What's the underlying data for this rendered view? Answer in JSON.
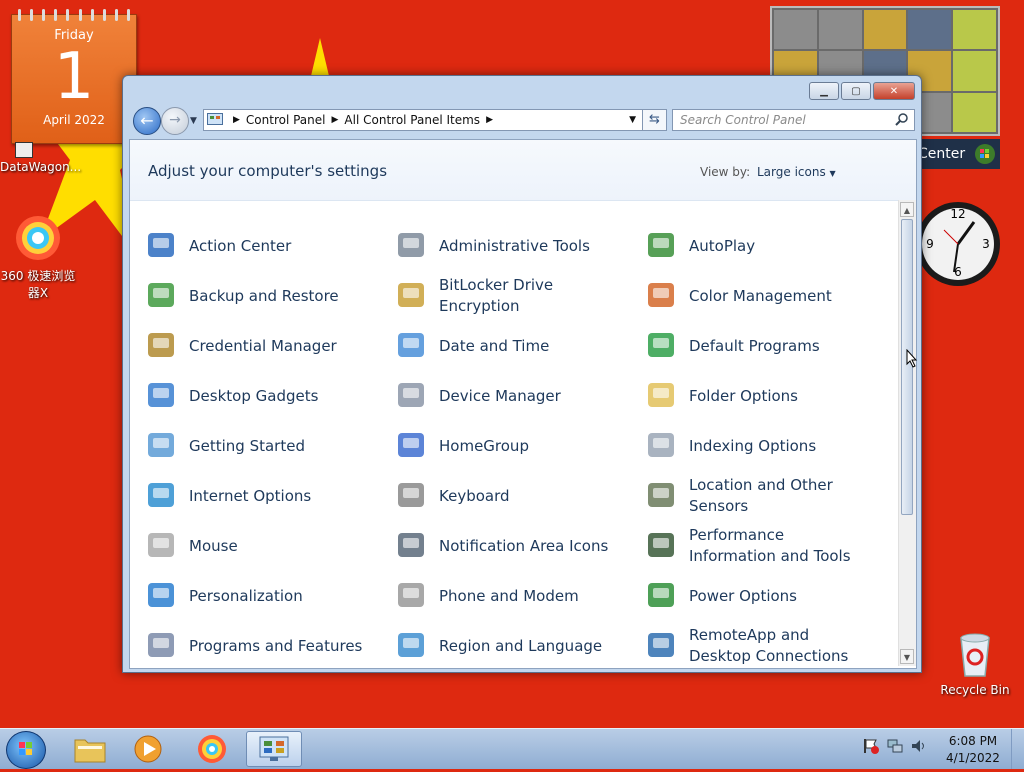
{
  "desktop": {
    "calendar": {
      "weekday": "Friday",
      "day": "1",
      "month_year": "April 2022"
    },
    "icons": [
      {
        "label": "DataWagon..."
      },
      {
        "label": "360 极速浏览器X"
      },
      {
        "label": "Recycle Bin"
      }
    ],
    "media_center_label": "Center",
    "clock_numbers": [
      "12",
      "3",
      "6",
      "9"
    ]
  },
  "window": {
    "address": {
      "crumbs": [
        "Control Panel",
        "All Control Panel Items"
      ]
    },
    "search": {
      "placeholder": "Search Control Panel"
    },
    "header_title": "Adjust your computer's settings",
    "view_by_label": "View by:",
    "view_by_value": "Large icons",
    "items": [
      {
        "label": "Action Center",
        "icon": "flag-icon"
      },
      {
        "label": "Administrative Tools",
        "icon": "admin-tools-icon"
      },
      {
        "label": "AutoPlay",
        "icon": "autoplay-icon"
      },
      {
        "label": "Backup and Restore",
        "icon": "backup-icon"
      },
      {
        "label": "BitLocker Drive Encryption",
        "icon": "bitlocker-key-icon"
      },
      {
        "label": "Color Management",
        "icon": "color-management-icon"
      },
      {
        "label": "Credential Manager",
        "icon": "credential-vault-icon"
      },
      {
        "label": "Date and Time",
        "icon": "calendar-clock-icon"
      },
      {
        "label": "Default Programs",
        "icon": "default-programs-icon"
      },
      {
        "label": "Desktop Gadgets",
        "icon": "desktop-gadgets-icon"
      },
      {
        "label": "Device Manager",
        "icon": "device-manager-icon"
      },
      {
        "label": "Folder Options",
        "icon": "folder-icon"
      },
      {
        "label": "Getting Started",
        "icon": "getting-started-icon"
      },
      {
        "label": "HomeGroup",
        "icon": "homegroup-icon"
      },
      {
        "label": "Indexing Options",
        "icon": "indexing-icon"
      },
      {
        "label": "Internet Options",
        "icon": "globe-icon"
      },
      {
        "label": "Keyboard",
        "icon": "keyboard-icon"
      },
      {
        "label": "Location and Other Sensors",
        "icon": "sensors-icon"
      },
      {
        "label": "Mouse",
        "icon": "mouse-icon"
      },
      {
        "label": "Notification Area Icons",
        "icon": "notification-icon"
      },
      {
        "label": "Performance Information and Tools",
        "icon": "performance-icon"
      },
      {
        "label": "Personalization",
        "icon": "personalization-icon"
      },
      {
        "label": "Phone and Modem",
        "icon": "phone-icon"
      },
      {
        "label": "Power Options",
        "icon": "power-icon"
      },
      {
        "label": "Programs and Features",
        "icon": "programs-icon"
      },
      {
        "label": "Region and Language",
        "icon": "region-globe-icon"
      },
      {
        "label": "RemoteApp and Desktop Connections",
        "icon": "remoteapp-icon"
      }
    ]
  },
  "taskbar": {
    "time": "6:08 PM",
    "date": "4/1/2022"
  }
}
